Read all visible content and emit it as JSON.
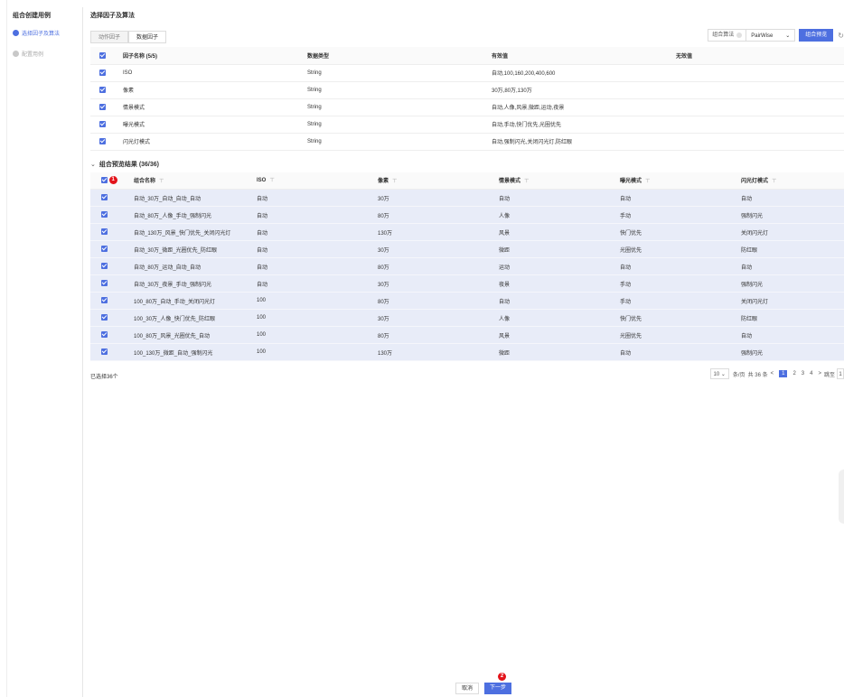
{
  "steps": {
    "title": "组合创建用例",
    "items": [
      {
        "label": "选择因子及算法",
        "state": "active"
      },
      {
        "label": "配置用例",
        "state": "inactive"
      }
    ]
  },
  "section": {
    "title": "选择因子及算法"
  },
  "tabs": [
    {
      "label": "动作因子",
      "active": false
    },
    {
      "label": "数据因子",
      "active": true
    }
  ],
  "algo": {
    "label": "组合算法",
    "help_icon": "question-icon",
    "value": "PairWise",
    "preview_button": "组合预览",
    "refresh_icon": "refresh-icon"
  },
  "factor_table": {
    "headers": [
      "因子名称 (5/5)",
      "数据类型",
      "有效值",
      "无效值"
    ],
    "rows": [
      [
        "ISO",
        "String",
        "自动,100,160,200,400,600",
        ""
      ],
      [
        "像素",
        "String",
        "30万,80万,130万",
        ""
      ],
      [
        "情景模式",
        "String",
        "自动,人像,风景,微距,运动,夜景",
        ""
      ],
      [
        "曝光模式",
        "String",
        "自动,手动,快门优先,光圈优先",
        ""
      ],
      [
        "闪光灯模式",
        "String",
        "自动,强制闪光,关闭闪光灯,防红眼",
        ""
      ]
    ]
  },
  "preview": {
    "title": "组合预览结果 (36/36)",
    "badge": "1",
    "headers": [
      "组合名称",
      "ISO",
      "像素",
      "情景模式",
      "曝光模式",
      "闪光灯模式"
    ],
    "rows": [
      [
        "自动_30万_自动_自动_自动",
        "自动",
        "30万",
        "自动",
        "自动",
        "自动"
      ],
      [
        "自动_80万_人像_手动_强制闪光",
        "自动",
        "80万",
        "人像",
        "手动",
        "强制闪光"
      ],
      [
        "自动_130万_风景_快门优先_关闭闪光灯",
        "自动",
        "130万",
        "风景",
        "快门优先",
        "关闭闪光灯"
      ],
      [
        "自动_30万_微距_光圈优先_防红眼",
        "自动",
        "30万",
        "微距",
        "光圈优先",
        "防红眼"
      ],
      [
        "自动_80万_运动_自动_自动",
        "自动",
        "80万",
        "运动",
        "自动",
        "自动"
      ],
      [
        "自动_30万_夜景_手动_强制闪光",
        "自动",
        "30万",
        "夜景",
        "手动",
        "强制闪光"
      ],
      [
        "100_80万_自动_手动_关闭闪光灯",
        "100",
        "80万",
        "自动",
        "手动",
        "关闭闪光灯"
      ],
      [
        "100_30万_人像_快门优先_防红眼",
        "100",
        "30万",
        "人像",
        "快门优先",
        "防红眼"
      ],
      [
        "100_80万_风景_光圈优先_自动",
        "100",
        "80万",
        "风景",
        "光圈优先",
        "自动"
      ],
      [
        "100_130万_微距_自动_强制闪光",
        "100",
        "130万",
        "微距",
        "自动",
        "强制闪光"
      ]
    ],
    "selected_text": "已选择36个"
  },
  "pagination": {
    "page_size": "10",
    "per_page_label": "条/页",
    "total_label": "共 36 条",
    "prev": "<",
    "pages": [
      "1",
      "2",
      "3",
      "4"
    ],
    "next": ">",
    "jump_label": "跳至",
    "jump_value": "1"
  },
  "actions": {
    "cancel": "取消",
    "next": "下一步",
    "badge": "2"
  },
  "colors": {
    "accent": "#4d6fe0",
    "row_selected": "#e8ecf8",
    "badge": "#e3141b"
  }
}
